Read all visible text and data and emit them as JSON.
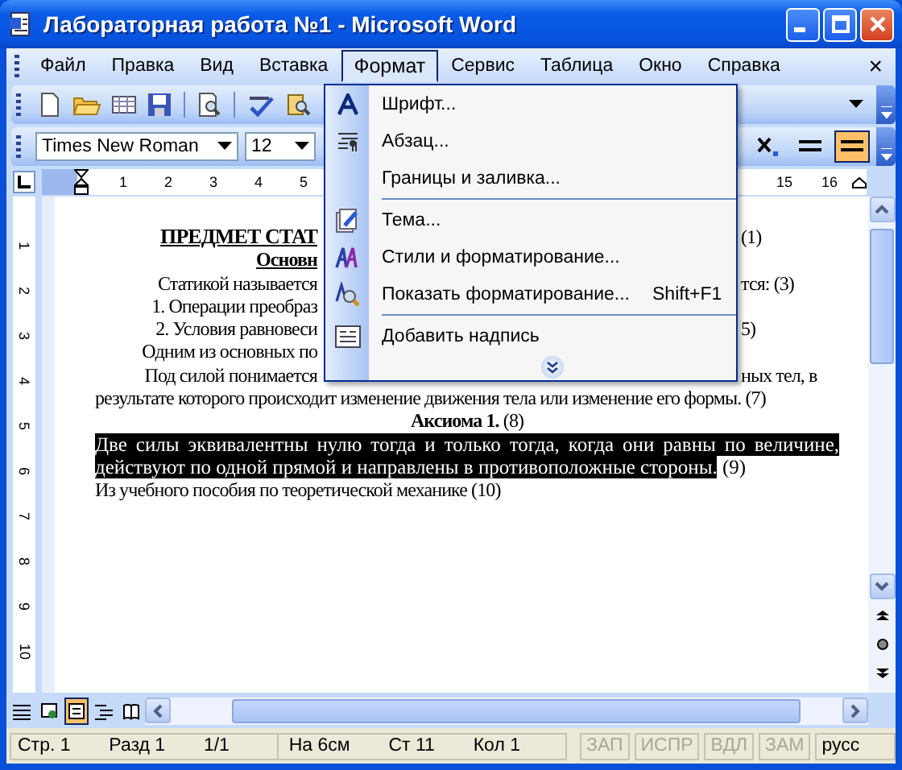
{
  "window": {
    "title": "Лабораторная работа №1 - Microsoft Word"
  },
  "menu_bar": {
    "items": [
      {
        "label": "Файл",
        "selected": false
      },
      {
        "label": "Правка",
        "selected": false
      },
      {
        "label": "Вид",
        "selected": false
      },
      {
        "label": "Вставка",
        "selected": false
      },
      {
        "label": "Формат",
        "selected": true
      },
      {
        "label": "Сервис",
        "selected": false
      },
      {
        "label": "Таблица",
        "selected": false
      },
      {
        "label": "Окно",
        "selected": false
      },
      {
        "label": "Справка",
        "selected": false
      }
    ],
    "close": "×"
  },
  "formatting_toolbar": {
    "font": "Times New Roman",
    "size": "12",
    "toggles": [
      {
        "kind": "subscript",
        "on": false
      },
      {
        "kind": "double-line",
        "on": false
      },
      {
        "kind": "double-line",
        "on": true
      }
    ]
  },
  "ruler": {
    "left_labels": [
      "1",
      "2",
      "3",
      "4",
      "5"
    ],
    "right_labels": [
      "15",
      "16"
    ],
    "vertical_labels": [
      "1",
      "2",
      "3",
      "4",
      "5",
      "6",
      "7",
      "8",
      "9",
      "10"
    ]
  },
  "format_menu": {
    "items": [
      {
        "kind": "item",
        "label": "Шрифт..."
      },
      {
        "kind": "item",
        "label": "Абзац..."
      },
      {
        "kind": "item",
        "label": "Границы и заливка..."
      },
      {
        "kind": "separator"
      },
      {
        "kind": "item",
        "label": "Тема..."
      },
      {
        "kind": "item",
        "label": "Стили и форматирование..."
      },
      {
        "kind": "item",
        "label": "Показать форматирование...",
        "shortcut": "Shift+F1"
      },
      {
        "kind": "separator"
      },
      {
        "kind": "item",
        "label": "Добавить надпись"
      },
      {
        "kind": "expand"
      }
    ]
  },
  "document": {
    "partial_lines": [
      {
        "kind": "heading",
        "left": "ПРЕДМЕТ СТАТ",
        "right": "(1)"
      },
      {
        "kind": "subheading",
        "left": "Основн"
      },
      {
        "kind": "text",
        "left": "Статикой называется",
        "right": "тся:  (3)"
      },
      {
        "kind": "text",
        "left": "1. Операции преобраз"
      },
      {
        "kind": "text",
        "left": "2. Условия равновеси",
        "right": "5)"
      },
      {
        "kind": "text",
        "left": "Одним из основных по"
      },
      {
        "kind": "text",
        "left": "Под силой понимается",
        "right": "ных тел, в"
      }
    ],
    "lines": [
      {
        "kind": "justified",
        "text": "результате которого происходит изменение движения тела или изменение его формы. (7)"
      },
      {
        "kind": "centered",
        "text": "**Аксиома 1.** (8)"
      },
      {
        "kind": "selected",
        "text": "Две силы эквивалентны нулю тогда и только тогда, когда они равны по  величине, действуют по одной прямой и направлены в противоположные стороны.",
        "tail": " (9)"
      },
      {
        "kind": "plain",
        "text": "Из учебного пособия по теоретической механике (10)"
      }
    ]
  },
  "view_buttons": [
    {
      "selected": false
    },
    {
      "selected": false
    },
    {
      "selected": true
    },
    {
      "selected": false
    },
    {
      "selected": false
    }
  ],
  "status_bar": {
    "fields": [
      {
        "kind": "text",
        "text": "Стр. 1"
      },
      {
        "kind": "text",
        "text": "Разд 1"
      },
      {
        "kind": "text",
        "text": "1/1"
      },
      {
        "kind": "gap"
      },
      {
        "kind": "text",
        "text": "На 6см"
      },
      {
        "kind": "text",
        "text": "Ст 11"
      },
      {
        "kind": "text",
        "text": "Кол 1"
      }
    ],
    "modes": [
      {
        "text": "ЗАП",
        "disabled": true
      },
      {
        "text": "ИСПР",
        "disabled": true
      },
      {
        "text": "ВДЛ",
        "disabled": true
      },
      {
        "text": "ЗАМ",
        "disabled": true
      }
    ],
    "language": "русс"
  }
}
